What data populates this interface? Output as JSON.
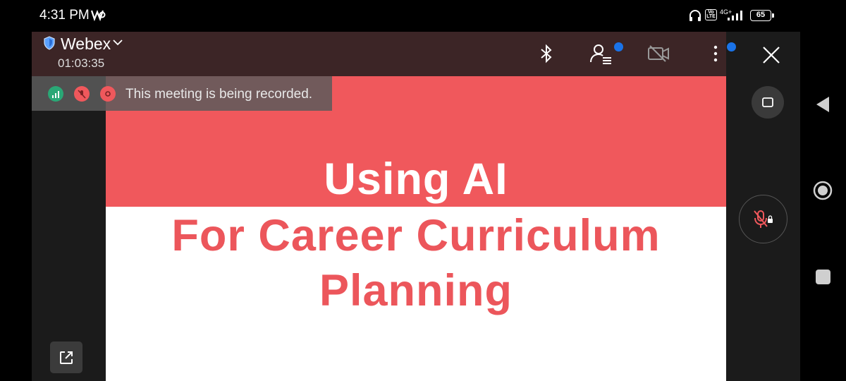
{
  "status_bar": {
    "time": "4:31 PM",
    "signal_label": "4G+",
    "battery": "65"
  },
  "header": {
    "app_title": "Webex",
    "timer": "01:03:35",
    "dot_color": "#1a73e8"
  },
  "recording_banner": {
    "text": "This meeting is being recorded."
  },
  "slide": {
    "title": "Using AI",
    "subtitle_line1": "For Career Curriculum",
    "subtitle_line2": "Planning",
    "accent_color": "#f0585c"
  },
  "icons": {
    "bluetooth": "bluetooth-icon",
    "participants": "participants-icon",
    "video_off": "video-off-icon",
    "more": "more-vertical-icon",
    "close": "close-icon",
    "share": "share-icon",
    "mute": "mic-muted-icon"
  }
}
